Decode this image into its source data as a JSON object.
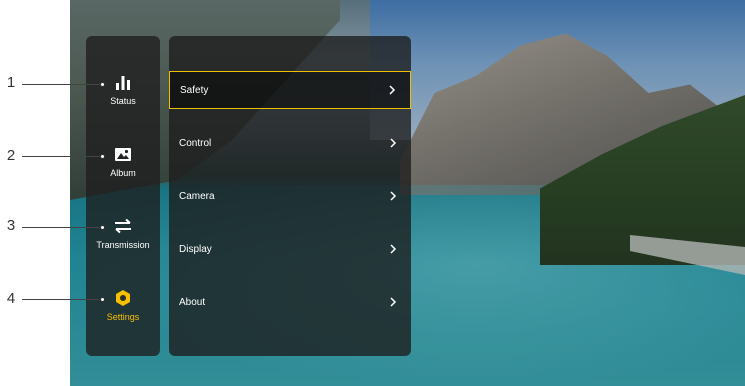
{
  "rail": {
    "items": [
      {
        "label": "Status",
        "icon": "bar-chart-icon"
      },
      {
        "label": "Album",
        "icon": "image-icon"
      },
      {
        "label": "Transmission",
        "icon": "swap-arrows-icon"
      },
      {
        "label": "Settings",
        "icon": "settings-hex-icon"
      }
    ],
    "active_index": 3,
    "active_color": "#f6c000"
  },
  "menu": {
    "items": [
      {
        "label": "Safety"
      },
      {
        "label": "Control"
      },
      {
        "label": "Camera"
      },
      {
        "label": "Display"
      },
      {
        "label": "About"
      }
    ],
    "selected_index": 0,
    "selected_border_color": "#f0c000",
    "chevron_icon": "chevron-right-icon"
  },
  "callouts": [
    "1",
    "2",
    "3",
    "4"
  ]
}
